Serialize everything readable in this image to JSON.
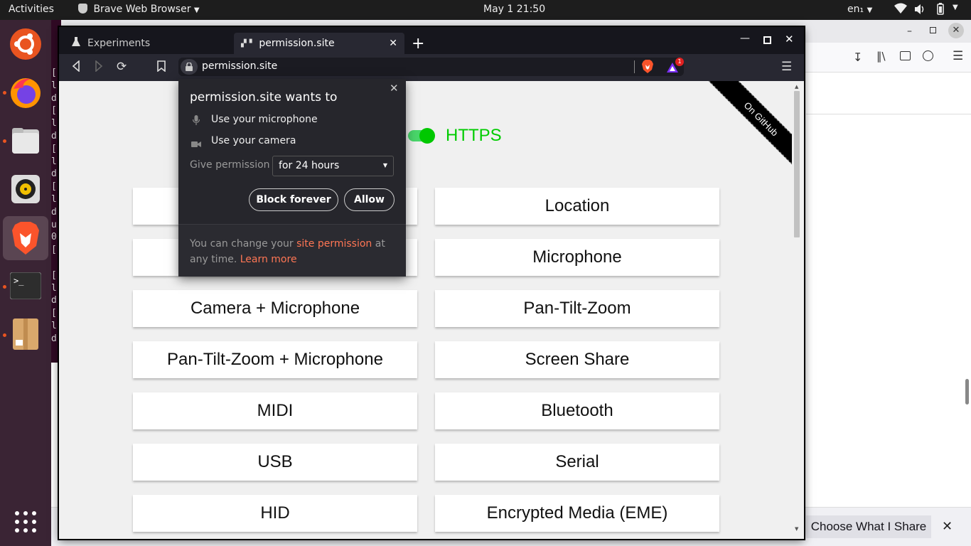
{
  "topbar": {
    "activities": "Activities",
    "app_name": "Brave Web Browser",
    "clock": "May 1  21:50",
    "language": "en₁"
  },
  "dock": {
    "items": [
      "ubuntu-software",
      "firefox",
      "files",
      "rhythmbox",
      "brave",
      "terminal",
      "archive-manager"
    ]
  },
  "terminal": {
    "lines": [
      "[",
      "l",
      "d",
      "[",
      "l",
      "d",
      "[",
      "l",
      "d",
      "[",
      "l",
      "d",
      "u",
      "0",
      "[",
      "",
      "[",
      "l",
      "d",
      "[",
      "l",
      "d",
      ""
    ]
  },
  "brave": {
    "tabs": [
      {
        "title": "Experiments",
        "active": false
      },
      {
        "title": "permission.site",
        "active": true
      }
    ],
    "url": "permission.site",
    "shields_badge": "1"
  },
  "page": {
    "https_label": "HTTPS",
    "github_ribbon": "On GitHub",
    "left_buttons": [
      "",
      "",
      "Camera + Microphone",
      "Pan-Tilt-Zoom + Microphone",
      "MIDI",
      "USB",
      "HID"
    ],
    "right_buttons": [
      "Location",
      "Microphone",
      "Pan-Tilt-Zoom",
      "Screen Share",
      "Bluetooth",
      "Serial",
      "Encrypted Media (EME)"
    ]
  },
  "popup": {
    "title": "permission.site wants to",
    "perm_mic": "Use your microphone",
    "perm_cam": "Use your camera",
    "give_label": "Give permission",
    "duration": "for 24 hours",
    "block_label": "Block forever",
    "allow_label": "Allow",
    "footer_pre": "You can change your ",
    "footer_link": "site permission",
    "footer_mid": " at any time. ",
    "learn_more": "Learn more"
  },
  "background_window": {
    "share_label": "Choose What I Share"
  },
  "colors": {
    "accent_orange": "#e95420",
    "https_green": "#00cc00",
    "link_orange": "#ff7654"
  }
}
